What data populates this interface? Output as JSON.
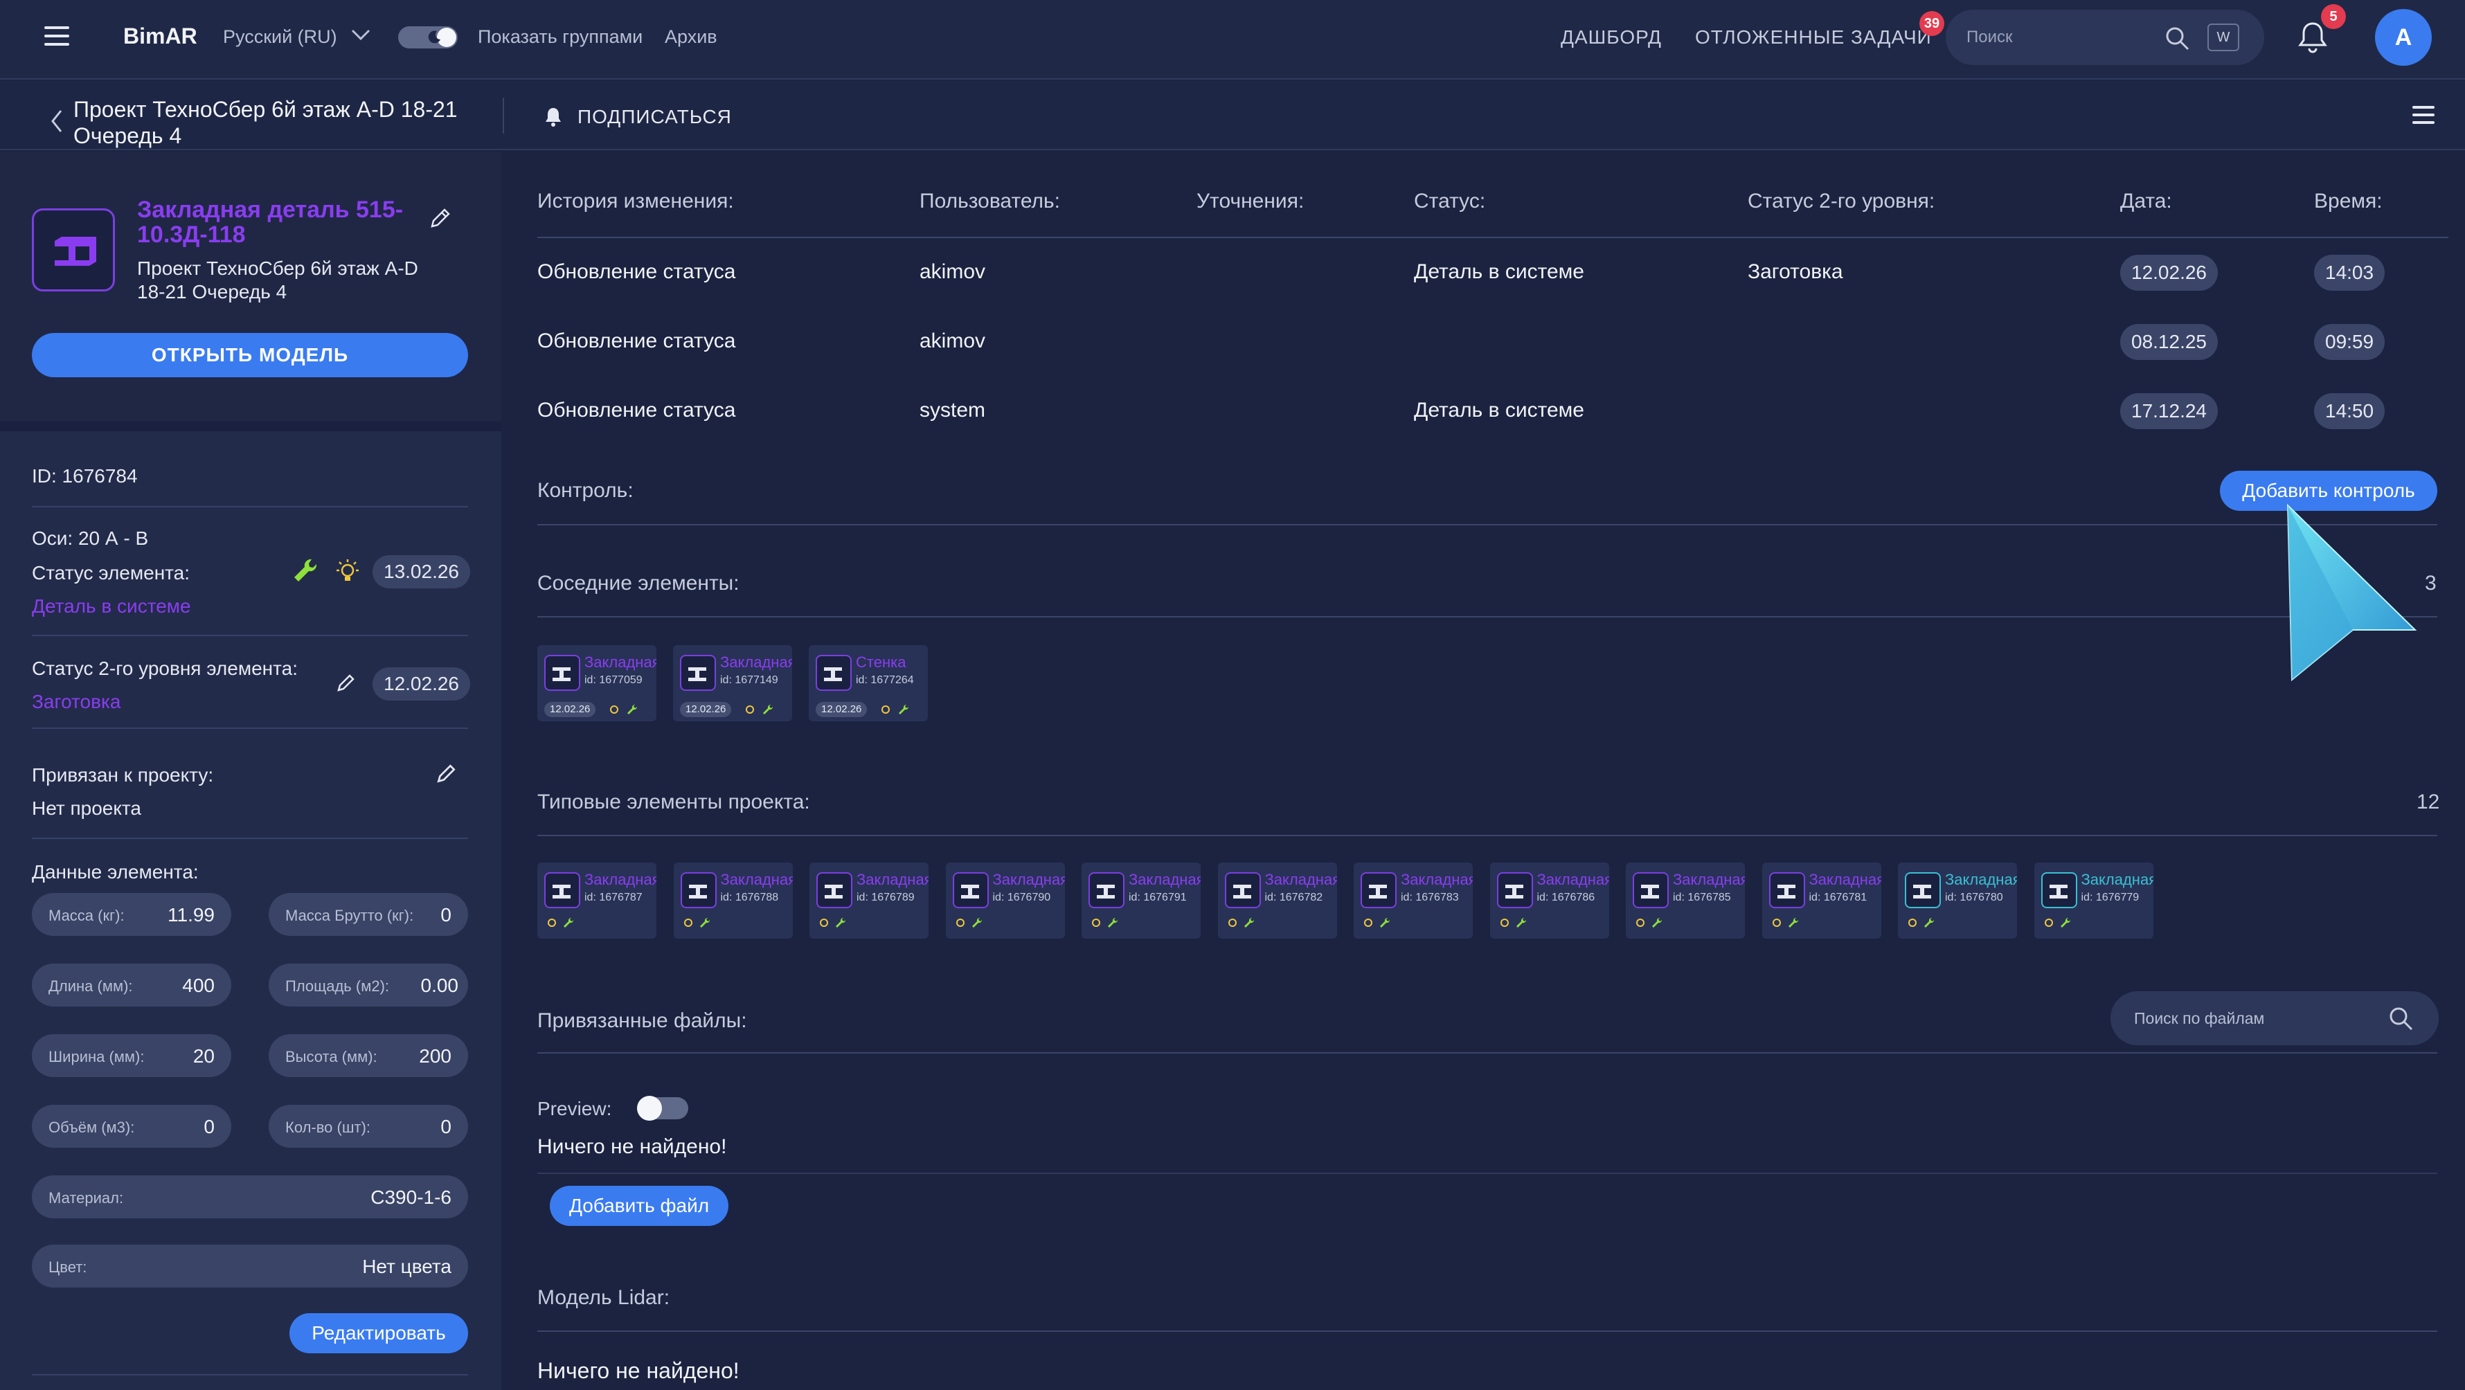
{
  "topbar": {
    "logo": "BimAR",
    "language": "Русский (RU)",
    "show_groups": "Показать группами",
    "archive": "Архив",
    "nav_dashboard": "ДАШБОРД",
    "nav_deferred": "ОТЛОЖЕННЫЕ ЗАДАЧИ",
    "deferred_badge": "39",
    "search_placeholder": "Поиск",
    "search_key": "W",
    "notifications_badge": "5",
    "avatar_letter": "A"
  },
  "subbar": {
    "project_title": "Проект ТехноСбер 6й этаж A-D 18-21 Очередь 4",
    "subscribe": "ПОДПИСАТЬСЯ"
  },
  "element": {
    "title": "Закладная деталь 515-10.3Д-118",
    "project": "Проект ТехноСбер 6й этаж A-D 18-21 Очередь 4",
    "open_model": "ОТКРЫТЬ МОДЕЛЬ",
    "id_line": "ID: 1676784",
    "axes_line": "Оси: 20 А - В",
    "status_label": "Статус элемента:",
    "status_value": "Деталь в системе",
    "status_date": "13.02.26",
    "status2_label": "Статус 2-го уровня элемента:",
    "status2_value": "Заготовка",
    "status2_date": "12.02.26",
    "bound_label": "Привязан к проекту:",
    "bound_value": "Нет проекта",
    "data_label": "Данные элемента:",
    "fields": [
      {
        "label": "Масса (кг):",
        "value": "11.99"
      },
      {
        "label": "Масса Брутто (кг):",
        "value": "0"
      },
      {
        "label": "Длина (мм):",
        "value": "400"
      },
      {
        "label": "Площадь (м2):",
        "value": "0.00"
      },
      {
        "label": "Ширина (мм):",
        "value": "20"
      },
      {
        "label": "Высота (мм):",
        "value": "200"
      },
      {
        "label": "Объём (м3):",
        "value": "0"
      },
      {
        "label": "Кол-во (шт):",
        "value": "0"
      },
      {
        "label": "Материал:",
        "value": "С390-1-6"
      },
      {
        "label": "Цвет:",
        "value": "Нет цвета"
      }
    ],
    "edit_button": "Редактировать"
  },
  "history": {
    "headers": [
      "История изменения:",
      "Пользователь:",
      "Уточнения:",
      "Статус:",
      "Статус 2-го уровня:",
      "Дата:",
      "Время:"
    ],
    "rows": [
      {
        "action": "Обновление статуса",
        "user": "akimov",
        "status": "Деталь в системе",
        "status2": "Заготовка",
        "date": "12.02.26",
        "time": "14:03"
      },
      {
        "action": "Обновление статуса",
        "user": "akimov",
        "status": "",
        "status2": "",
        "date": "08.12.25",
        "time": "09:59"
      },
      {
        "action": "Обновление статуса",
        "user": "system",
        "status": "Деталь в системе",
        "status2": "",
        "date": "17.12.24",
        "time": "14:50"
      }
    ]
  },
  "control": {
    "title": "Контроль:",
    "add_button": "Добавить контроль"
  },
  "neighbors": {
    "title": "Соседние элементы:",
    "count": "3",
    "items": [
      {
        "name": "Закладная",
        "id": "id: 1677059",
        "date": "12.02.26"
      },
      {
        "name": "Закладная",
        "id": "id: 1677149",
        "date": "12.02.26"
      },
      {
        "name": "Стенка",
        "id": "id: 1677264",
        "date": "12.02.26"
      }
    ]
  },
  "typical": {
    "title": "Типовые элементы проекта:",
    "count": "12",
    "items": [
      {
        "name": "Закладная",
        "id": "id: 1676787"
      },
      {
        "name": "Закладная",
        "id": "id: 1676788"
      },
      {
        "name": "Закладная",
        "id": "id: 1676789"
      },
      {
        "name": "Закладная",
        "id": "id: 1676790"
      },
      {
        "name": "Закладная",
        "id": "id: 1676791"
      },
      {
        "name": "Закладная",
        "id": "id: 1676782"
      },
      {
        "name": "Закладная",
        "id": "id: 1676783"
      },
      {
        "name": "Закладная",
        "id": "id: 1676786"
      },
      {
        "name": "Закладная",
        "id": "id: 1676785"
      },
      {
        "name": "Закладная",
        "id": "id: 1676781"
      },
      {
        "name": "Закладная",
        "id": "id: 1676780"
      },
      {
        "name": "Закладная",
        "id": "id: 1676779"
      }
    ]
  },
  "files": {
    "title": "Привязанные файлы:",
    "search_placeholder": "Поиск по файлам",
    "preview_label": "Preview:",
    "empty": "Ничего не найдено!",
    "add_button": "Добавить файл"
  },
  "lidar": {
    "title": "Модель Lidar:",
    "empty": "Ничего не найдено!"
  },
  "colors": {
    "accent": "#3a7bf0",
    "purple": "#8a3df0",
    "teal": "#3bbfd1",
    "badge": "#e33b4f",
    "wrench": "#8fe03a",
    "sun": "#f0c73a"
  }
}
